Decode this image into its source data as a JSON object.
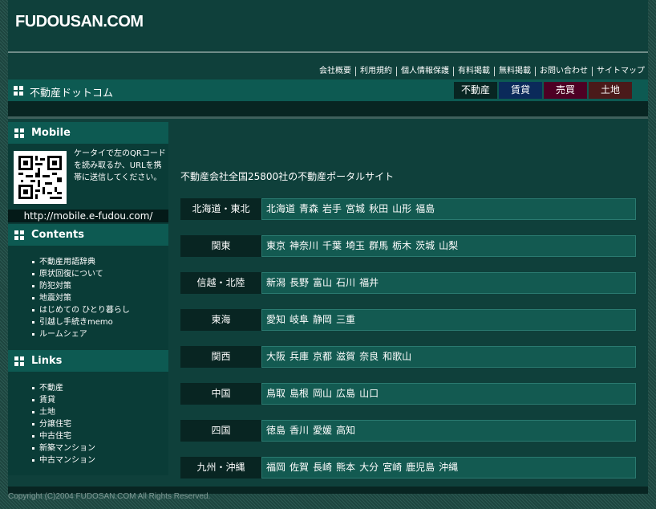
{
  "header": {
    "logo": "FUDOUSAN.COM",
    "util_links": [
      "会社概要",
      "利用規約",
      "個人情報保護",
      "有料掲載",
      "無料掲載",
      "お問い合わせ",
      "サイトマップ"
    ]
  },
  "titlebar": {
    "site_name": "不動産ドットコム",
    "categories": [
      {
        "label": "不動産",
        "color": "#082522"
      },
      {
        "label": "賃貸",
        "color": "#0b2a5a"
      },
      {
        "label": "売買",
        "color": "#4d0024"
      },
      {
        "label": "土地",
        "color": "#4a1a1a"
      }
    ]
  },
  "sidebar": {
    "mobile": {
      "title": "Mobile",
      "text": "ケータイで左のQRコードを読み取るか、URLを携帯に送信してください。",
      "url": "http://mobile.e-fudou.com/"
    },
    "contents": {
      "title": "Contents",
      "items": [
        "不動産用語辞典",
        "原状回復について",
        "防犯対策",
        "地震対策",
        "はじめての ひとり暮らし",
        "引越し手続きmemo",
        "ルームシェア"
      ]
    },
    "links": {
      "title": "Links",
      "items": [
        "不動産",
        "賃貸",
        "土地",
        "分譲住宅",
        "中古住宅",
        "新築マンション",
        "中古マンション"
      ]
    }
  },
  "main": {
    "tagline": "不動産会社全国25800社の不動産ポータルサイト",
    "regions": [
      {
        "name": "北海道・東北",
        "prefs": [
          "北海道",
          "青森",
          "岩手",
          "宮城",
          "秋田",
          "山形",
          "福島"
        ]
      },
      {
        "name": "関東",
        "prefs": [
          "東京",
          "神奈川",
          "千葉",
          "埼玉",
          "群馬",
          "栃木",
          "茨城",
          "山梨"
        ]
      },
      {
        "name": "信越・北陸",
        "prefs": [
          "新潟",
          "長野",
          "富山",
          "石川",
          "福井"
        ]
      },
      {
        "name": "東海",
        "prefs": [
          "愛知",
          "岐阜",
          "静岡",
          "三重"
        ]
      },
      {
        "name": "関西",
        "prefs": [
          "大阪",
          "兵庫",
          "京都",
          "滋賀",
          "奈良",
          "和歌山"
        ]
      },
      {
        "name": "中国",
        "prefs": [
          "鳥取",
          "島根",
          "岡山",
          "広島",
          "山口"
        ]
      },
      {
        "name": "四国",
        "prefs": [
          "徳島",
          "香川",
          "愛媛",
          "高知"
        ]
      },
      {
        "name": "九州・沖縄",
        "prefs": [
          "福岡",
          "佐賀",
          "長崎",
          "熊本",
          "大分",
          "宮崎",
          "鹿児島",
          "沖縄"
        ]
      }
    ]
  },
  "footer": {
    "copyright": "Copyright (C)2004 FUDOSAN.COM All Rights Reserved."
  }
}
